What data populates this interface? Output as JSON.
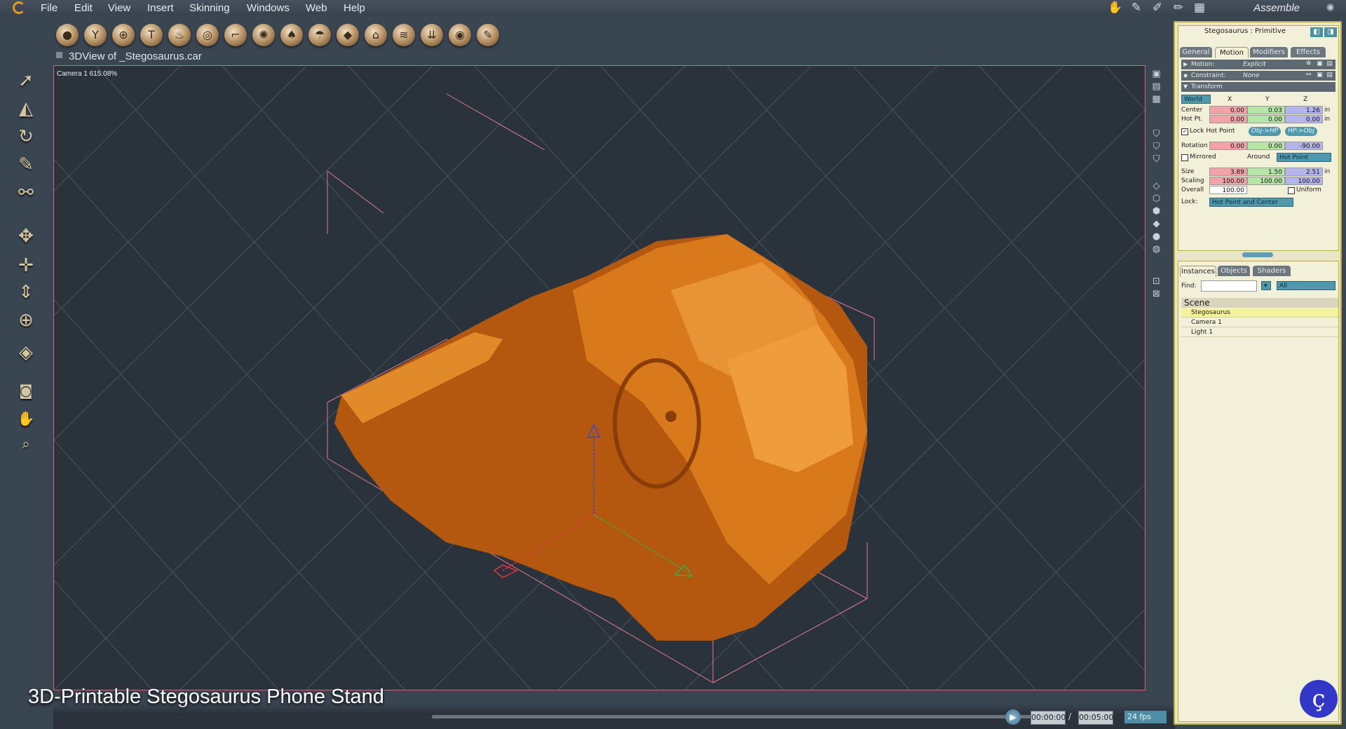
{
  "menubar": {
    "items": [
      "File",
      "Edit",
      "View",
      "Insert",
      "Skinning",
      "Windows",
      "Web",
      "Help"
    ],
    "room": "Assemble"
  },
  "toolbar": {
    "tools": [
      "sphere",
      "cup",
      "globe",
      "text",
      "flame",
      "torus",
      "lathe",
      "gear",
      "shell",
      "spline",
      "extrude",
      "arch",
      "bridge",
      "spring",
      "ring",
      "pen"
    ]
  },
  "viewport": {
    "title": "3DView of _Stegosaurus.car",
    "camera_label": "Camera 1 615.08%",
    "object_color": "#c96a16",
    "grid_color": "#4a5460",
    "box_color": "#e07b8e"
  },
  "caption": "3D-Printable Stegosaurus Phone Stand",
  "timeline": {
    "current": "00:00:00",
    "separator": "/",
    "end": "00:05:00",
    "fps": "24 fps"
  },
  "panel": {
    "title": "Stegosaurus : Primitive",
    "tabs": [
      "General",
      "Motion",
      "Modifiers",
      "Effects"
    ],
    "active_tab": "Motion",
    "motion": {
      "label": "Motion:",
      "value": "Explicit"
    },
    "constraint": {
      "label": "Constraint:",
      "value": "None"
    },
    "transform": {
      "label": "Transform",
      "space": "World",
      "axes": [
        "X",
        "Y",
        "Z"
      ],
      "center": {
        "label": "Center",
        "x": "0.00",
        "y": "0.03",
        "z": "1.26",
        "unit": "in"
      },
      "hot_point": {
        "label": "Hot Pt.",
        "x": "0.00",
        "y": "0.00",
        "z": "0.00",
        "unit": "in"
      },
      "lock_hot_point": "Lock Hot Point",
      "obj_hp": "Obj->HP",
      "hp_obj": "HP->Obj",
      "rotation": {
        "label": "Rotation",
        "x": "0.00",
        "y": "0.00",
        "z": "-90.00"
      },
      "mirrored": "Mirrored",
      "around": "Around",
      "around_value": "Hot Point",
      "size": {
        "label": "Size",
        "x": "3.89",
        "y": "1.50",
        "z": "2.51",
        "unit": "in"
      },
      "scaling": {
        "label": "Scaling",
        "x": "100.00",
        "y": "100.00",
        "z": "100.00"
      },
      "overall": {
        "label": "Overall",
        "value": "100.00"
      },
      "uniform": "Uniform",
      "lock": {
        "label": "Lock:",
        "value": "Hot Point and Center"
      }
    }
  },
  "browser": {
    "tabs": [
      "Instances",
      "Objects",
      "Shaders"
    ],
    "active_tab": "Instances",
    "find_label": "Find:",
    "filter": "All",
    "scene_header": "Scene",
    "items": [
      "Stegosaurus",
      "Camera 1",
      "Light 1"
    ],
    "selected": "Stegosaurus"
  }
}
